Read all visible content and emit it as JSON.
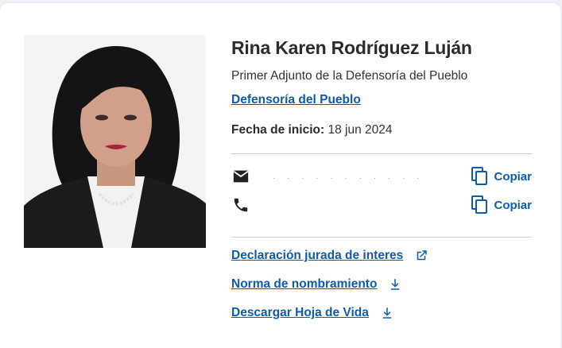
{
  "profile": {
    "name": "Rina Karen Rodríguez Luján",
    "role": "Primer Adjunto de la Defensoría del Pueblo",
    "organization": "Defensoría del Pueblo",
    "start_label": "Fecha de inicio:",
    "start_date": "18 jun 2024"
  },
  "contact": {
    "email_redacted": "· · ·  ·  · · · ·  ·  · ·",
    "email_icon": "mail-icon",
    "phone_icon": "phone-icon",
    "copy_label": "Copiar"
  },
  "links": {
    "declaration": "Declaración jurada de interes",
    "appointment": "Norma de nombramiento",
    "cv": "Descargar Hoja de Vida"
  },
  "colors": {
    "link": "#0b5cab",
    "text": "#2b2b2b",
    "divider": "#cfcfcf"
  }
}
